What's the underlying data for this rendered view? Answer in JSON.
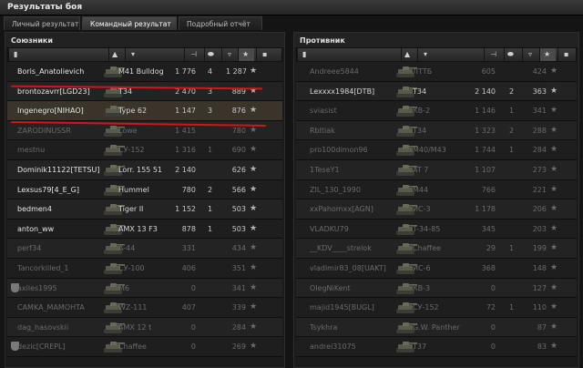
{
  "window": {
    "title": "Результаты боя"
  },
  "tabs": [
    {
      "label": "Личный результат",
      "active": false
    },
    {
      "label": "Командный результат",
      "active": true
    },
    {
      "label": "Подробный отчёт",
      "active": false
    }
  ],
  "allies": {
    "title": "Союзники",
    "rows": [
      {
        "name": "Boris_Anatolievich",
        "tank": "M41 Bulldog",
        "damage": "1 776",
        "kills": "4",
        "xp": "1 287",
        "dead": false,
        "hl": false,
        "squad": false
      },
      {
        "name": "brontozavrr[LGD23]",
        "tank": "T34",
        "damage": "2 470",
        "kills": "3",
        "xp": "889",
        "dead": false,
        "hl": false,
        "squad": false
      },
      {
        "name": "Ingenegro[NIHAO]",
        "tank": "Type 62",
        "damage": "1 147",
        "kills": "3",
        "xp": "876",
        "dead": false,
        "hl": true,
        "squad": false
      },
      {
        "name": "ZARODINUSSR",
        "tank": "Lowe",
        "damage": "1 415",
        "kills": "",
        "xp": "780",
        "dead": true,
        "hl": false,
        "squad": false
      },
      {
        "name": "mestnu",
        "tank": "СУ-152",
        "damage": "1 316",
        "kills": "1",
        "xp": "690",
        "dead": true,
        "hl": false,
        "squad": false
      },
      {
        "name": "Dominik11122[TETSU]",
        "tank": "Lorr. 155 51",
        "damage": "2 140",
        "kills": "",
        "xp": "626",
        "dead": false,
        "hl": false,
        "squad": false
      },
      {
        "name": "Lexsus79[4_E_G]",
        "tank": "Hummel",
        "damage": "780",
        "kills": "2",
        "xp": "566",
        "dead": false,
        "hl": false,
        "squad": false
      },
      {
        "name": "bedmen4",
        "tank": "Tiger II",
        "damage": "1 152",
        "kills": "1",
        "xp": "503",
        "dead": false,
        "hl": false,
        "squad": false
      },
      {
        "name": "anton_ww",
        "tank": "AMX 13 F3",
        "damage": "878",
        "kills": "1",
        "xp": "503",
        "dead": false,
        "hl": false,
        "squad": false
      },
      {
        "name": "perf34",
        "tank": "A-44",
        "damage": "331",
        "kills": "",
        "xp": "434",
        "dead": true,
        "hl": false,
        "squad": false
      },
      {
        "name": "Tancorkilled_1",
        "tank": "СУ-100",
        "damage": "406",
        "kills": "",
        "xp": "351",
        "dead": true,
        "hl": false,
        "squad": false
      },
      {
        "name": "axiles1995",
        "tank": "M6",
        "damage": "0",
        "kills": "",
        "xp": "341",
        "dead": true,
        "hl": false,
        "squad": true
      },
      {
        "name": "CAMKA_MAMOHTA",
        "tank": "WZ-111",
        "damage": "407",
        "kills": "",
        "xp": "339",
        "dead": true,
        "hl": false,
        "squad": false
      },
      {
        "name": "dag_hasovskii",
        "tank": "AMX 12 t",
        "damage": "0",
        "kills": "",
        "xp": "284",
        "dead": true,
        "hl": false,
        "squad": false
      },
      {
        "name": "dezic[CREPL]",
        "tank": "Chaffee",
        "damage": "0",
        "kills": "",
        "xp": "269",
        "dead": true,
        "hl": false,
        "squad": true
      }
    ]
  },
  "enemies": {
    "title": "Противник",
    "rows": [
      {
        "name": "Andreee5844",
        "tank": "ЛТТБ",
        "damage": "605",
        "kills": "",
        "xp": "424",
        "dead": true
      },
      {
        "name": "Lexxxx1984[DTB]",
        "tank": "T34",
        "damage": "2 140",
        "kills": "2",
        "xp": "363",
        "dead": false
      },
      {
        "name": "sviasist",
        "tank": "КВ-2",
        "damage": "1 146",
        "kills": "1",
        "xp": "341",
        "dead": true
      },
      {
        "name": "Rbltiak",
        "tank": "T34",
        "damage": "1 323",
        "kills": "2",
        "xp": "288",
        "dead": true
      },
      {
        "name": "pro100dimon96",
        "tank": "M40/M43",
        "damage": "1 744",
        "kills": "1",
        "xp": "284",
        "dead": true
      },
      {
        "name": "1TeseY1",
        "tank": "AT 7",
        "damage": "1 107",
        "kills": "",
        "xp": "273",
        "dead": true
      },
      {
        "name": "ZIL_130_1990",
        "tank": "M44",
        "damage": "766",
        "kills": "",
        "xp": "221",
        "dead": true
      },
      {
        "name": "xxPahomxx[AGN]",
        "tank": "ИС-3",
        "damage": "1 178",
        "kills": "",
        "xp": "206",
        "dead": true
      },
      {
        "name": "VLADKU79",
        "tank": "T-34-85",
        "damage": "345",
        "kills": "",
        "xp": "203",
        "dead": true
      },
      {
        "name": "__KDV____strelok",
        "tank": "Chaffee",
        "damage": "29",
        "kills": "1",
        "xp": "199",
        "dead": true
      },
      {
        "name": "vladimir83_08[UAKT]",
        "tank": "ИС-6",
        "damage": "368",
        "kills": "",
        "xp": "148",
        "dead": true
      },
      {
        "name": "OlegNiKent",
        "tank": "КВ-3",
        "damage": "0",
        "kills": "",
        "xp": "127",
        "dead": true
      },
      {
        "name": "majid1945[BUGL]",
        "tank": "СУ-152",
        "damage": "72",
        "kills": "1",
        "xp": "110",
        "dead": true
      },
      {
        "name": "Tsykhra",
        "tank": "G.W. Panther",
        "damage": "0",
        "kills": "",
        "xp": "87",
        "dead": true
      },
      {
        "name": "andrei31075",
        "tank": "T37",
        "damage": "0",
        "kills": "",
        "xp": "83",
        "dead": true
      }
    ]
  },
  "icons": {
    "star": "star-icon",
    "tank": "tank-icon",
    "squad": "squad-icon",
    "medal": "medal-icon"
  },
  "colors": {
    "highlight": "#3a342a",
    "annotation": "#d8121a"
  }
}
